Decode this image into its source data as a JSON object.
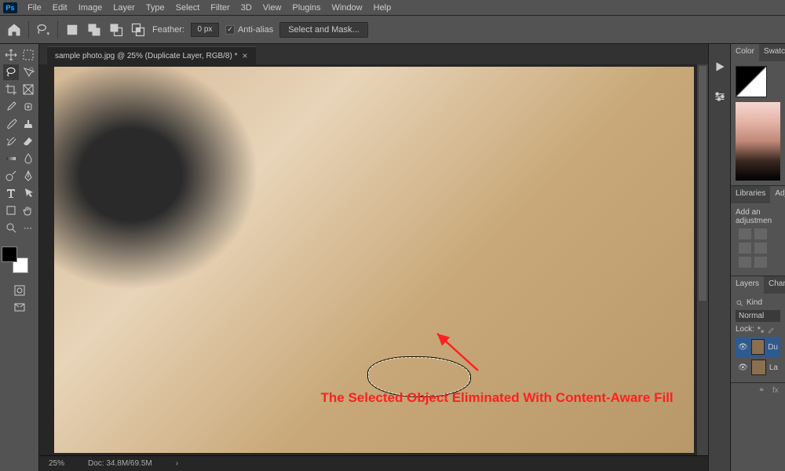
{
  "app": {
    "logo": "Ps"
  },
  "menu": [
    "File",
    "Edit",
    "Image",
    "Layer",
    "Type",
    "Select",
    "Filter",
    "3D",
    "View",
    "Plugins",
    "Window",
    "Help"
  ],
  "options": {
    "feather_label": "Feather:",
    "feather_value": "0 px",
    "anti_alias": "Anti-alias",
    "select_mask": "Select and Mask..."
  },
  "tab": {
    "title": "sample photo.jpg @ 25% (Duplicate Layer, RGB/8) *"
  },
  "annotation": {
    "text": "The Selected Object Eliminated With Content-Aware Fill"
  },
  "status": {
    "zoom": "25%",
    "doc": "Doc: 34.8M/69.5M"
  },
  "right": {
    "color_tab": "Color",
    "swatches_tab": "Swatche",
    "libraries_tab": "Libraries",
    "adjustments_tab": "Adju",
    "adjustments_hint": "Add an adjustmen",
    "layers_tab": "Layers",
    "channels_tab": "Chann",
    "kind_label": "Kind",
    "blend_mode": "Normal",
    "lock_label": "Lock:",
    "layers": [
      {
        "name": "Du"
      },
      {
        "name": "La"
      }
    ],
    "search_icon": "search"
  }
}
